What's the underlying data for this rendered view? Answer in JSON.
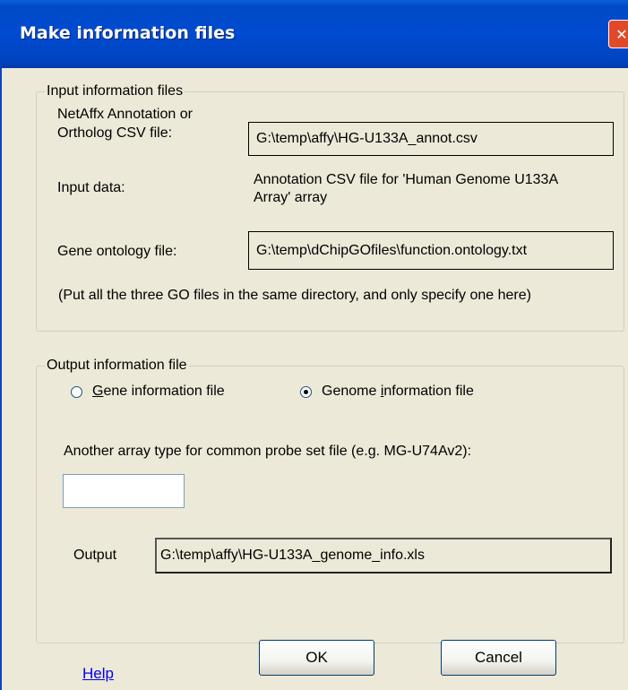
{
  "window": {
    "title": "Make information files",
    "close_glyph": "✕"
  },
  "input_group": {
    "legend": "Input information files",
    "annotation_label_line1": "NetAffx Annotation or",
    "annotation_label_line2": "Ortholog CSV file:",
    "annotation_value": "G:\\temp\\affy\\HG-U133A_annot.csv",
    "input_data_label": "Input data:",
    "input_data_value_line1": "Annotation CSV file for 'Human Genome U133A",
    "input_data_value_line2": "Array' array",
    "ontology_label": "Gene ontology file:",
    "ontology_value": "G:\\temp\\dChipGOfiles\\function.ontology.txt",
    "note": "(Put all the three GO files in the same directory, and only specify one here)"
  },
  "output_group": {
    "legend": "Output information file",
    "radio_gene_first": "G",
    "radio_gene_rest": "ene information file",
    "radio_genome_pre": "Genome ",
    "radio_genome_ul": "i",
    "radio_genome_rest": "nformation file",
    "selected": "genome",
    "common_label": "Another array type for common probe set file (e.g. MG-U74Av2):",
    "common_value": "",
    "output_label": "Output",
    "output_value": "G:\\temp\\affy\\HG-U133A_genome_info.xls"
  },
  "buttons": {
    "help": "Help",
    "ok": "OK",
    "cancel": "Cancel"
  }
}
